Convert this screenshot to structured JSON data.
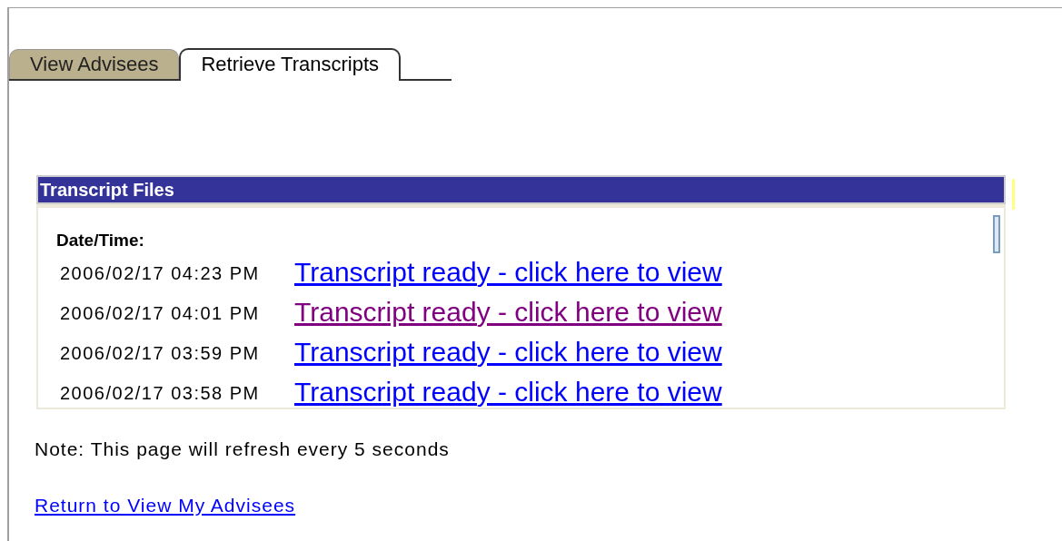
{
  "tabs": [
    {
      "label": "View Advisees",
      "selected": false
    },
    {
      "label": "Retrieve Transcripts",
      "selected": true
    }
  ],
  "panel": {
    "title": "Transcript Files",
    "column_header": "Date/Time:",
    "rows": [
      {
        "datetime": "2006/02/17 04:23 PM",
        "link": "Transcript ready - click here to view",
        "visited": false
      },
      {
        "datetime": "2006/02/17 04:01 PM",
        "link": "Transcript ready - click here to view",
        "visited": true
      },
      {
        "datetime": "2006/02/17 03:59 PM",
        "link": "Transcript ready - click here to view",
        "visited": false
      },
      {
        "datetime": "2006/02/17 03:58 PM",
        "link": "Transcript ready - click here to view",
        "visited": false
      }
    ]
  },
  "note": "Note: This page will refresh every 5 seconds",
  "return_link": "Return to View My Advisees"
}
